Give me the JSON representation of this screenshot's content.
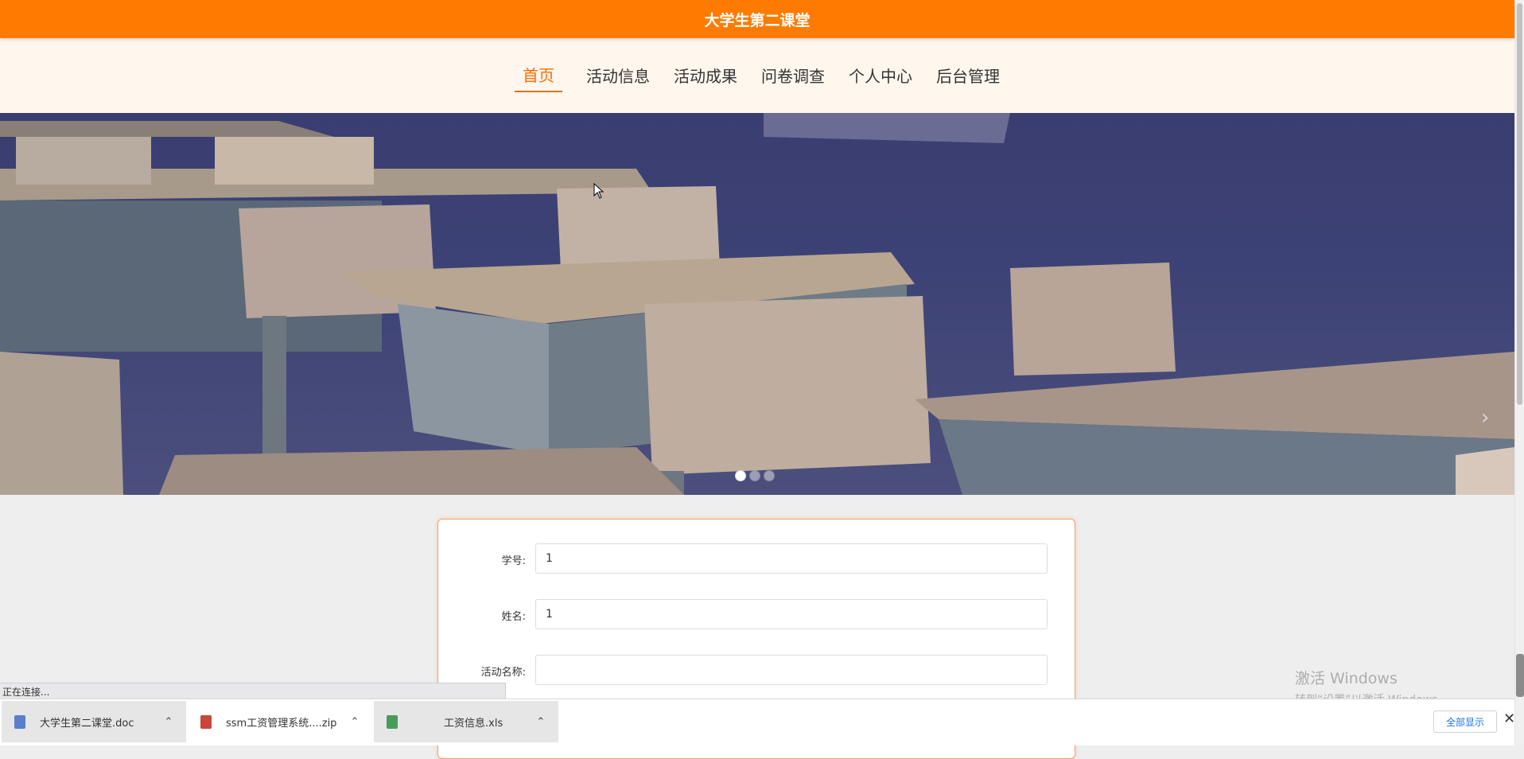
{
  "header": {
    "title": "大学生第二课堂"
  },
  "nav": {
    "items": [
      {
        "label": "首页",
        "active": true
      },
      {
        "label": "活动信息",
        "active": false
      },
      {
        "label": "活动成果",
        "active": false
      },
      {
        "label": "问卷调查",
        "active": false
      },
      {
        "label": "个人中心",
        "active": false
      },
      {
        "label": "后台管理",
        "active": false
      }
    ]
  },
  "banner": {
    "image": "classroom-desks-illustration",
    "slide_count": 3,
    "active_slide": 1,
    "next_icon": "chevron-right-icon"
  },
  "form": {
    "fields": [
      {
        "label": "学号:",
        "value": "1"
      },
      {
        "label": "姓名:",
        "value": "1"
      },
      {
        "label": "活动名称:",
        "value": ""
      }
    ]
  },
  "watermark": {
    "line1": "激活 Windows",
    "line2": "转到“设置”以激活 Windows。"
  },
  "status": {
    "text": "正在连接..."
  },
  "downloads": {
    "items": [
      {
        "name": "大学生第二课堂.doc",
        "icon": "doc-file-icon",
        "color": "#5b7ec8"
      },
      {
        "name": "ssm工资管理系统....zip",
        "icon": "zip-file-icon",
        "color": "#c8463a"
      },
      {
        "name": "工资信息.xls",
        "icon": "xls-file-icon",
        "color": "#4a9a5a"
      }
    ],
    "show_all": "全部显示",
    "close_icon": "close-icon"
  },
  "colors": {
    "brand": "#ff7b00",
    "nav_bg": "#fff7ee",
    "active_nav": "#ff6a00"
  }
}
